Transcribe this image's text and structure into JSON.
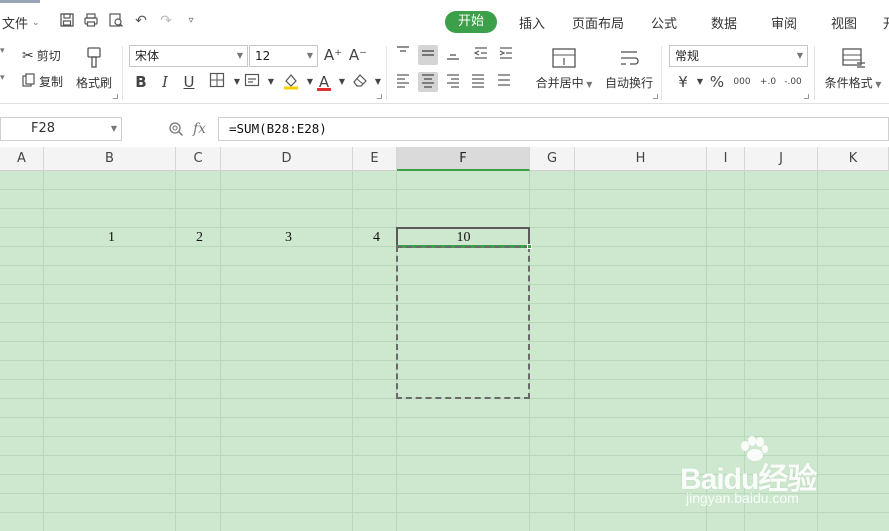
{
  "menubar": {
    "file_label": "文件",
    "tabs": [
      "开始",
      "插入",
      "页面布局",
      "公式",
      "数据",
      "审阅",
      "视图",
      "开"
    ],
    "active_tab": "开始"
  },
  "ribbon": {
    "cut_label": "剪切",
    "copy_label": "复制",
    "format_painter_label": "格式刷",
    "font_name": "宋体",
    "font_size": "12",
    "merge_center_label": "合并居中",
    "wrap_text_label": "自动换行",
    "number_format": "常规",
    "conditional_format_label": "条件格式",
    "bold": "B",
    "italic": "I",
    "underline": "U",
    "percent": "%",
    "font_color_letter": "A",
    "increase_font_label": "A⁺",
    "decrease_font_label": "A⁻",
    "thousands_label": "000",
    "increase_decimal_label": "+.0",
    "decrease_decimal_label": "-.00"
  },
  "formula_bar": {
    "name_box": "F28",
    "fx_label": "fx",
    "formula": "=SUM(B28:E28)"
  },
  "columns": [
    "A",
    "B",
    "C",
    "D",
    "E",
    "F",
    "G",
    "H",
    "I",
    "J",
    "K"
  ],
  "active_column": "F",
  "cells": {
    "b28": "1",
    "c28": "2",
    "d28": "3",
    "e28": "4",
    "f28": "10"
  },
  "colors": {
    "accent": "#3c9f4a",
    "grid_background": "#cde8cf"
  },
  "watermark": {
    "logo": "Baidu经验",
    "url": "jingyan.baidu.com"
  }
}
